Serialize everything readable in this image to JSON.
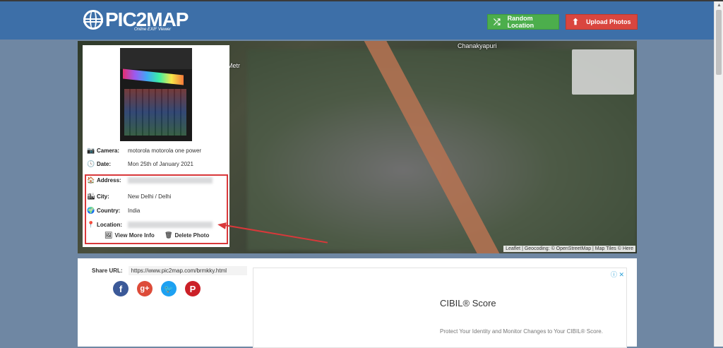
{
  "header": {
    "logo_text": "PIC2MAP",
    "logo_sub": "Online EXIF Viewer",
    "random_button": "Random Location",
    "upload_button": "Upload Photos"
  },
  "map": {
    "label_top": "Chanakyapuri",
    "label_area": "Metr",
    "attribution": "Leaflet | Geocoding: © OpenStreetMap | Map Tiles © Here"
  },
  "info": {
    "camera_label": "Camera:",
    "camera_value": "motorola motorola one power",
    "date_label": "Date:",
    "date_value": "Mon 25th of January 2021",
    "address_label": "Address:",
    "city_label": "City:",
    "city_value": "New Delhi / Delhi",
    "country_label": "Country:",
    "country_value": "India",
    "location_label": "Location:",
    "view_more": "View More Info",
    "delete_photo": "Delete Photo"
  },
  "share": {
    "label": "Share URL:",
    "url": "https://www.pic2map.com/brmkky.html"
  },
  "ad": {
    "title": "CIBIL® Score",
    "text": "Protect Your Identity and Monitor Changes to Your CIBIL® Score."
  },
  "colors": {
    "header": "#3d6fa8",
    "random": "#4cae4c",
    "upload": "#d9463f",
    "highlight": "#d9383a"
  }
}
